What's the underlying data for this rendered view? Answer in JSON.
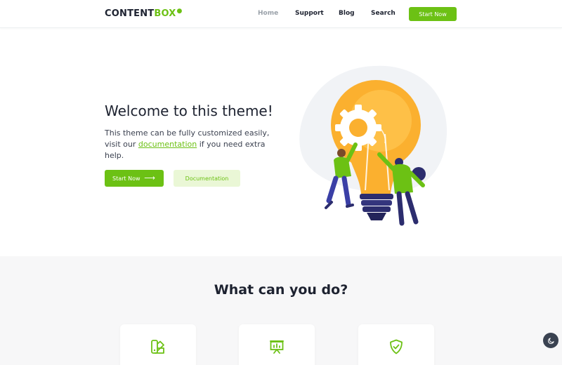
{
  "brand": {
    "logo_main": "CONTENT",
    "logo_accent": "BOX",
    "logo_mark": "●"
  },
  "nav": {
    "links": [
      {
        "label": "Home",
        "active": true
      },
      {
        "label": "Support",
        "active": false
      },
      {
        "label": "Blog",
        "active": false
      },
      {
        "label": "Search",
        "active": false
      }
    ],
    "cta_label": "Start Now"
  },
  "hero": {
    "title": "Welcome to this theme!",
    "text_before": "This theme can be fully customized easily, visit our ",
    "link_text": "documentation",
    "text_after": " if you need extra help.",
    "primary_button": "Start Now",
    "primary_icon": "arrow-right-icon",
    "secondary_button": "Documentation",
    "illustration": "lightbulb-gear-people-illustration"
  },
  "features": {
    "title": "What can you do?",
    "cards": [
      {
        "icon": "swatch-palette-icon"
      },
      {
        "icon": "presentation-board-icon"
      },
      {
        "icon": "shield-check-icon"
      }
    ]
  },
  "theme_toggle": {
    "icon": "moon-icon"
  },
  "colors": {
    "accent": "#6cc114",
    "accent_light": "#eaf7d6",
    "text_dark": "#1d2230",
    "muted": "#9aa1a9",
    "section_bg": "#f7f7f8"
  }
}
